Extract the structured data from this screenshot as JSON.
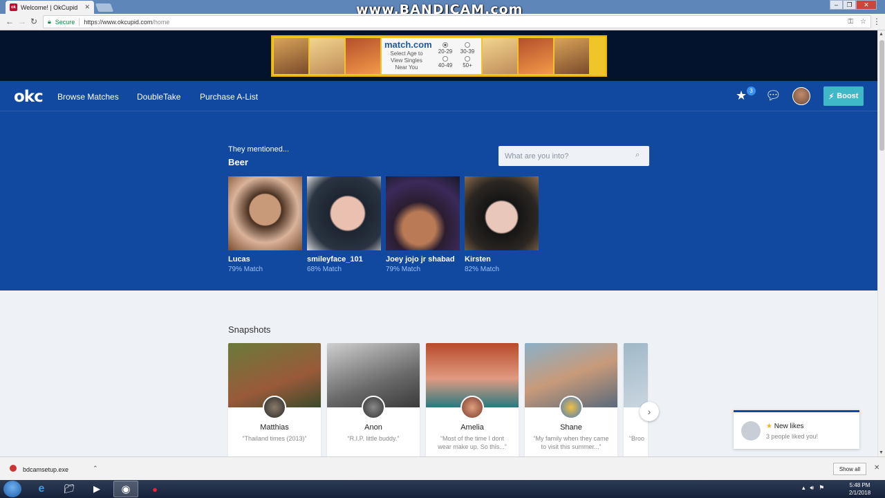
{
  "browser": {
    "tab_title": "Welcome! | OkCupid",
    "tab_favicon": "ok",
    "secure_label": "Secure",
    "url_host": "https://www.okcupid.com",
    "url_path": "/home",
    "watermark": "www.BANDICAM.com"
  },
  "ad": {
    "brand": "match.com",
    "text_lines": [
      "Select Age to",
      "View Singles",
      "Near You"
    ],
    "ages": [
      "20-29",
      "30-39",
      "40-49",
      "50+"
    ]
  },
  "nav": {
    "logo": "okc",
    "links": [
      "Browse Matches",
      "DoubleTake",
      "Purchase A-List"
    ],
    "likes_count": "3",
    "boost_label": "Boost"
  },
  "hero": {
    "mentioned": "They mentioned...",
    "topic": "Beer",
    "search_placeholder": "What are you into?",
    "profiles": [
      {
        "name": "Lucas",
        "match": "79% Match"
      },
      {
        "name": "smileyface_101",
        "match": "68% Match"
      },
      {
        "name": "Joey jojo jr shabad",
        "match": "79% Match"
      },
      {
        "name": "Kirsten",
        "match": "82% Match"
      }
    ]
  },
  "snapshots": {
    "title": "Snapshots",
    "items": [
      {
        "name": "Matthias",
        "caption": "“Thailand times (2013)”"
      },
      {
        "name": "Anon",
        "caption": "“R.I.P. little buddy.”"
      },
      {
        "name": "Amelia",
        "caption": "“Most of the time I dont wear make up. So this...”"
      },
      {
        "name": "Shane",
        "caption": "“My family when they came to visit this summer...”"
      },
      {
        "name": "",
        "caption": "“Broo"
      }
    ]
  },
  "notification": {
    "title": "New likes",
    "subtitle": "3 people liked you!"
  },
  "downloads": {
    "file": "bdcamsetup.exe",
    "show_all": "Show all"
  },
  "taskbar": {
    "time": "5:48 PM",
    "date": "2/1/2018"
  },
  "colors": {
    "okc_blue": "#1148a0",
    "boost": "#3fb8c7",
    "match_text": "#9fc2f5"
  }
}
